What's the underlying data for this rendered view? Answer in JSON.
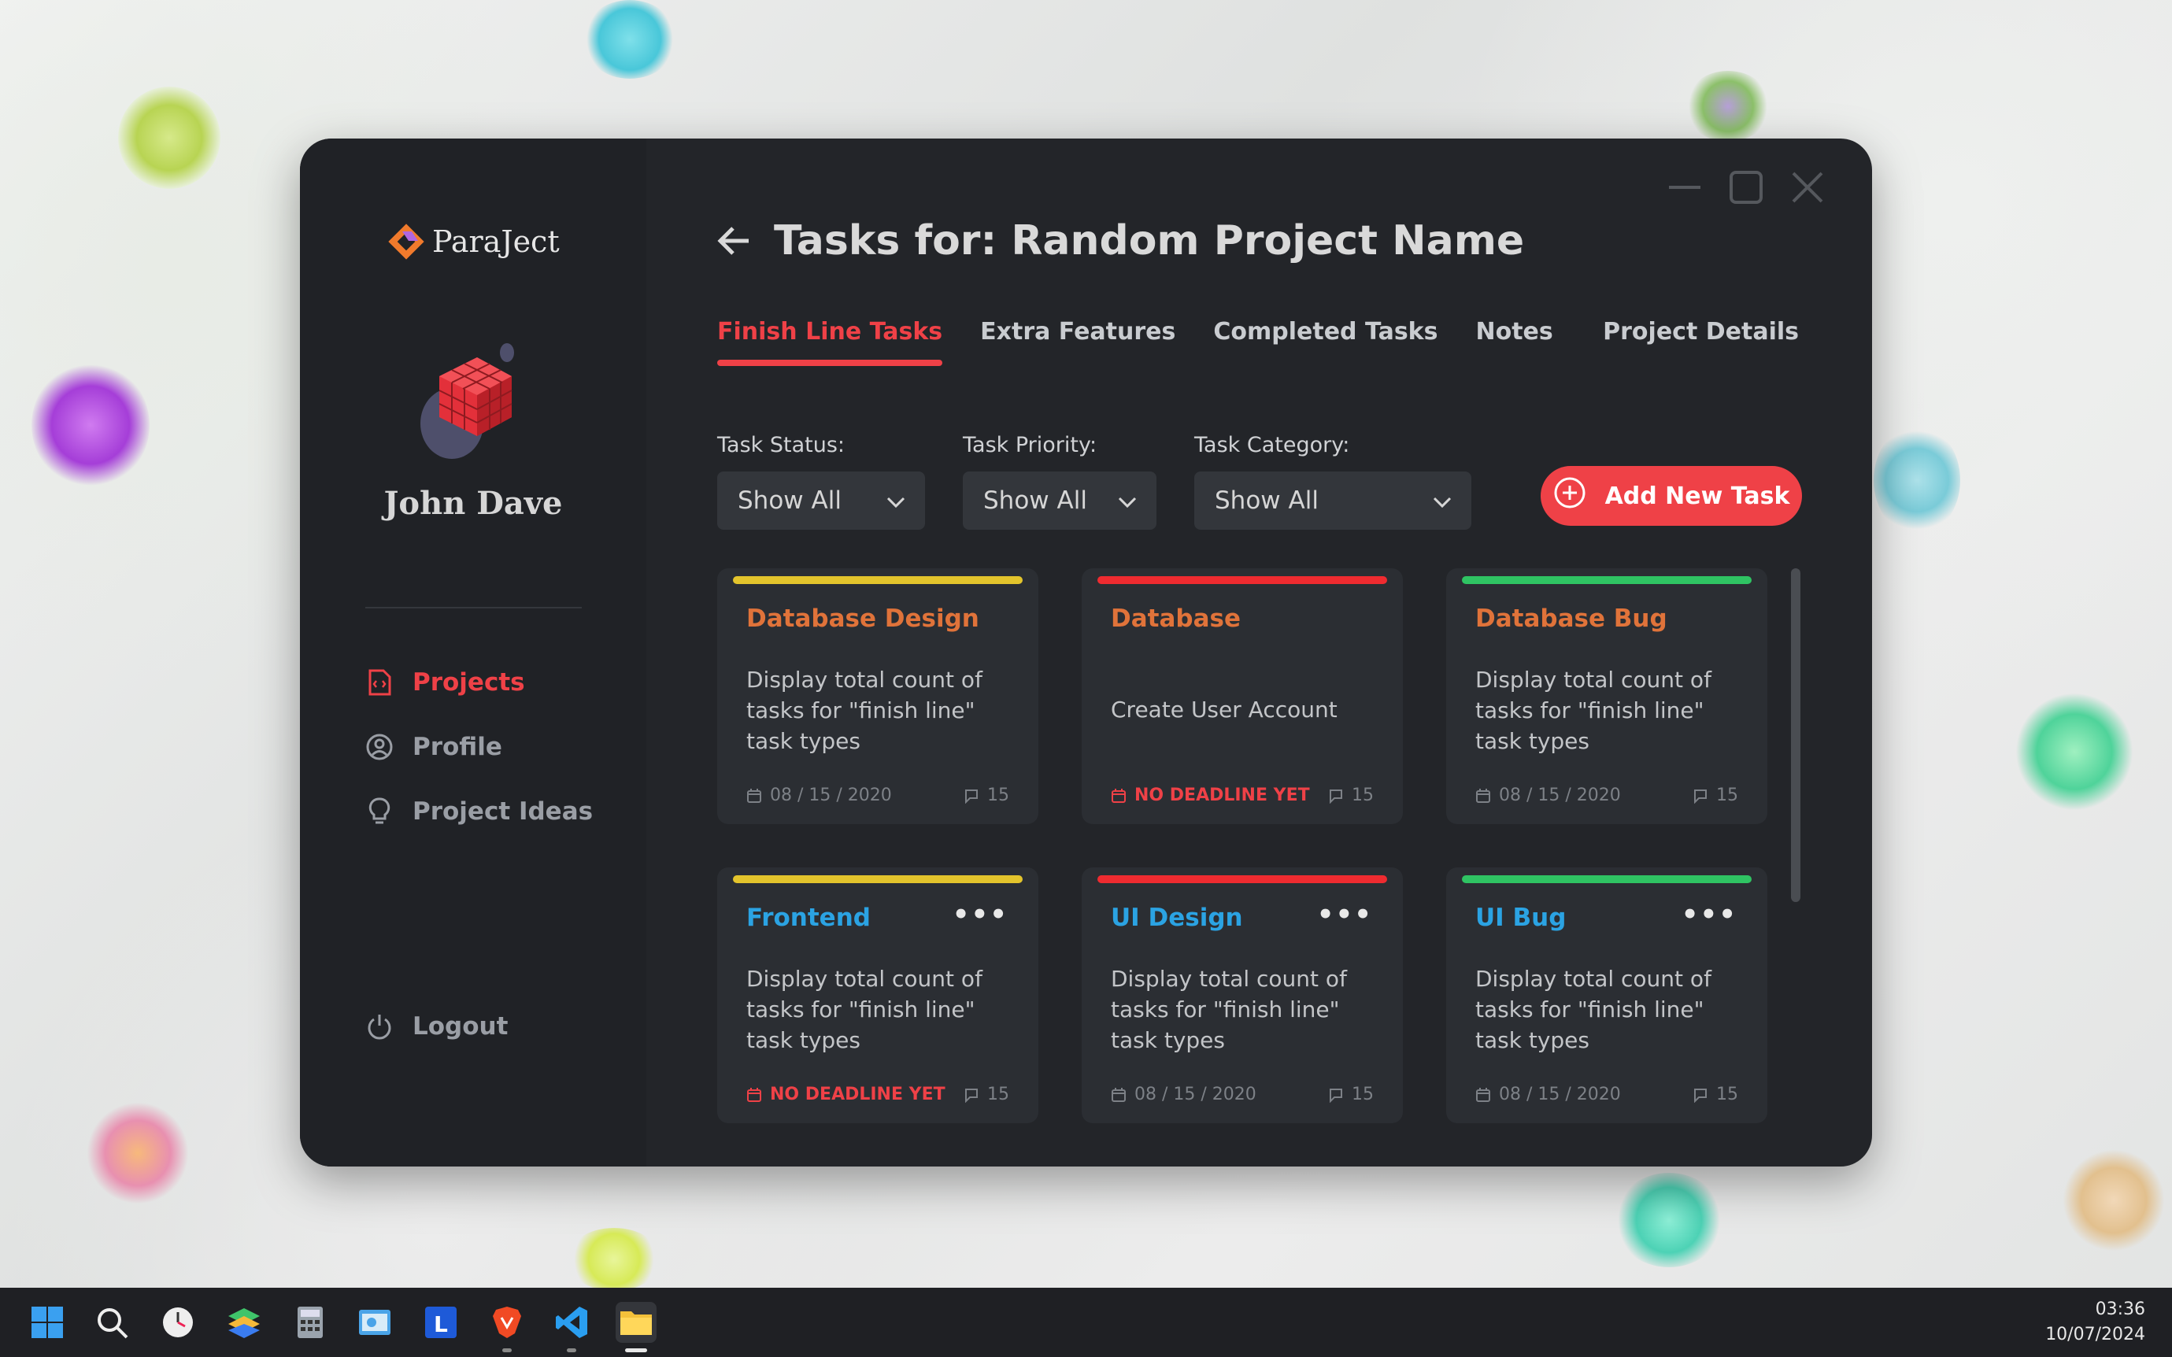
{
  "app": {
    "name": "ParaJect"
  },
  "user": {
    "name": "John Dave"
  },
  "sidebar": {
    "items": [
      {
        "label": "Projects",
        "icon": "project-file-icon",
        "active": true
      },
      {
        "label": "Profile",
        "icon": "user-circle-icon",
        "active": false
      },
      {
        "label": "Project Ideas",
        "icon": "lightbulb-icon",
        "active": false
      }
    ],
    "logout_label": "Logout"
  },
  "header": {
    "title": "Tasks for: Random Project Name"
  },
  "tabs": [
    {
      "label": "Finish Line Tasks",
      "active": true
    },
    {
      "label": "Extra Features",
      "active": false
    },
    {
      "label": "Completed Tasks",
      "active": false
    },
    {
      "label": "Notes",
      "active": false
    }
  ],
  "project_details_label": "Project Details",
  "filters": [
    {
      "label": "Task Status:",
      "value": "Show All"
    },
    {
      "label": "Task Priority:",
      "value": "Show All"
    },
    {
      "label": "Task Category:",
      "value": "Show All"
    }
  ],
  "add_task_label": "Add New Task",
  "colors": {
    "accent": "#ef4147",
    "orange_title": "#e0733a",
    "blue_title": "#2ba3e3",
    "priority_yellow": "#e3c42c",
    "priority_red": "#ef2b30",
    "priority_green": "#2fc463"
  },
  "tasks": [
    {
      "title": "Database Design",
      "description": "Display total count of tasks for \"finish line\" task types",
      "date": "08 / 15 / 2020",
      "comments": "15",
      "priority": "yellow",
      "title_color": "orange",
      "no_deadline": false,
      "menu": false
    },
    {
      "title": "Database",
      "description": "Create User Account",
      "date": "NO DEADLINE YET",
      "comments": "15",
      "priority": "red",
      "title_color": "orange",
      "no_deadline": true,
      "menu": false
    },
    {
      "title": "Database Bug",
      "description": "Display total count of tasks for \"finish line\" task types",
      "date": "08 / 15 / 2020",
      "comments": "15",
      "priority": "green",
      "title_color": "orange",
      "no_deadline": false,
      "menu": false
    },
    {
      "title": "Frontend",
      "description": "Display total count of tasks for \"finish line\" task types",
      "date": "NO DEADLINE YET",
      "comments": "15",
      "priority": "yellow",
      "title_color": "blue",
      "no_deadline": true,
      "menu": true
    },
    {
      "title": "UI Design",
      "description": "Display total count of tasks for \"finish line\" task types",
      "date": "08 / 15 / 2020",
      "comments": "15",
      "priority": "red",
      "title_color": "blue",
      "no_deadline": false,
      "menu": true
    },
    {
      "title": "UI Bug",
      "description": "Display total count of tasks for \"finish line\" task types",
      "date": "08 / 15 / 2020",
      "comments": "15",
      "priority": "green",
      "title_color": "blue",
      "no_deadline": false,
      "menu": true
    }
  ],
  "taskbar": {
    "icons": [
      "windows-start-icon",
      "search-icon",
      "clock-app-icon",
      "layers-app-icon",
      "calculator-icon",
      "control-panel-icon",
      "l-app-icon",
      "brave-browser-icon",
      "vscode-icon",
      "file-explorer-icon"
    ],
    "time": "03:36",
    "date": "10/07/2024"
  }
}
